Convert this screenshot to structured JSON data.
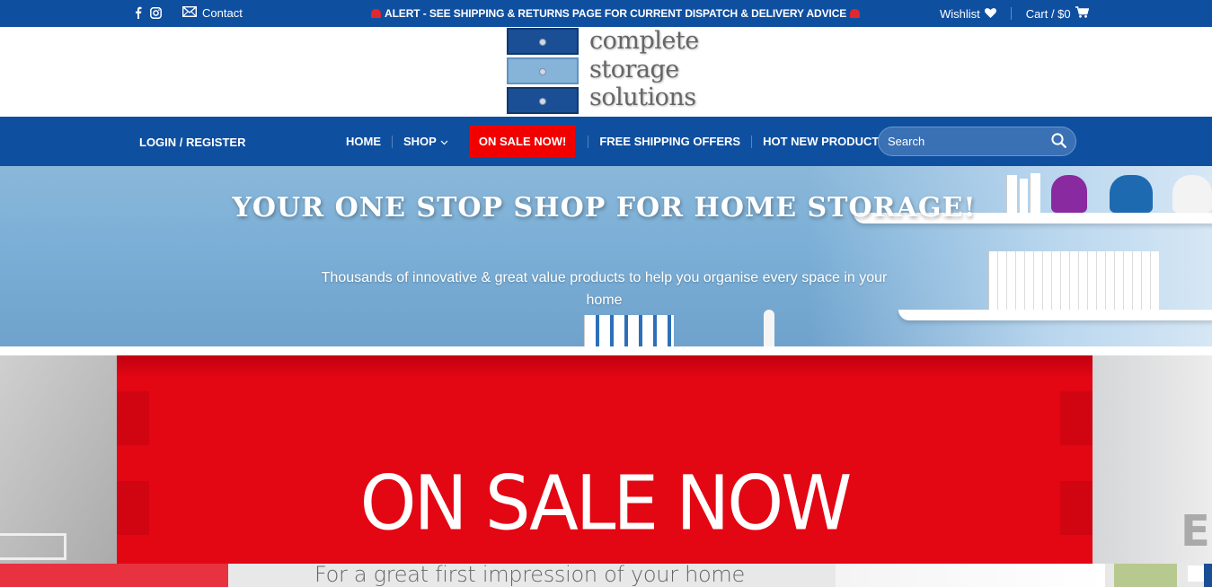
{
  "topbar": {
    "contact_label": "Contact",
    "alert_text": "ALERT - SEE SHIPPING & RETURNS PAGE FOR CURRENT DISPATCH & DELIVERY ADVICE",
    "wishlist_label": "Wishlist",
    "cart_label": "Cart / $0"
  },
  "logo": {
    "line1": "complete",
    "line2": "storage",
    "line3": "solutions"
  },
  "nav": {
    "login_label": "LOGIN / REGISTER",
    "items": [
      {
        "label": "HOME"
      },
      {
        "label": "SHOP"
      },
      {
        "label": "ON SALE NOW!"
      },
      {
        "label": "FREE SHIPPING OFFERS"
      },
      {
        "label": "HOT NEW PRODUCTS"
      }
    ],
    "search_placeholder": "Search"
  },
  "hero": {
    "title": "YOUR ONE STOP SHOP FOR HOME STORAGE!",
    "subtitle": "Thousands of innovative & great value products to help you organise every space in your home"
  },
  "promo": {
    "headline": "ON SALE NOW",
    "side_letter": "E",
    "strip_text": "For a great first impression of your home"
  },
  "colors": {
    "brand_blue": "#0f4fa0",
    "sale_red": "#f20000",
    "promo_red": "#e30613"
  }
}
